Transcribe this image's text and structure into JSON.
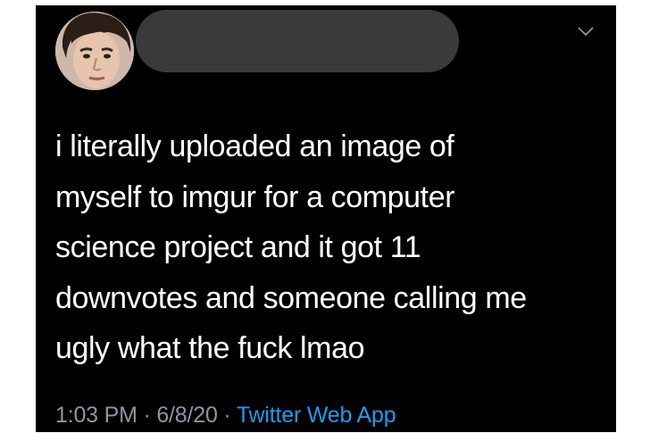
{
  "tweet": {
    "text_lines": [
      "i literally uploaded an image of",
      "myself to imgur for a computer",
      "science project and it got 11",
      "downvotes and someone calling me",
      "ugly what the fuck lmao"
    ],
    "time": "1:03 PM",
    "separator": "·",
    "date": "6/8/20",
    "source": "Twitter Web App"
  },
  "colors": {
    "background": "#000000",
    "text": "#ffffff",
    "meta": "#8b96a0",
    "link": "#1d9bf0",
    "redaction": "#3a3a3d"
  },
  "icons": {
    "menu": "chevron-down-icon"
  }
}
